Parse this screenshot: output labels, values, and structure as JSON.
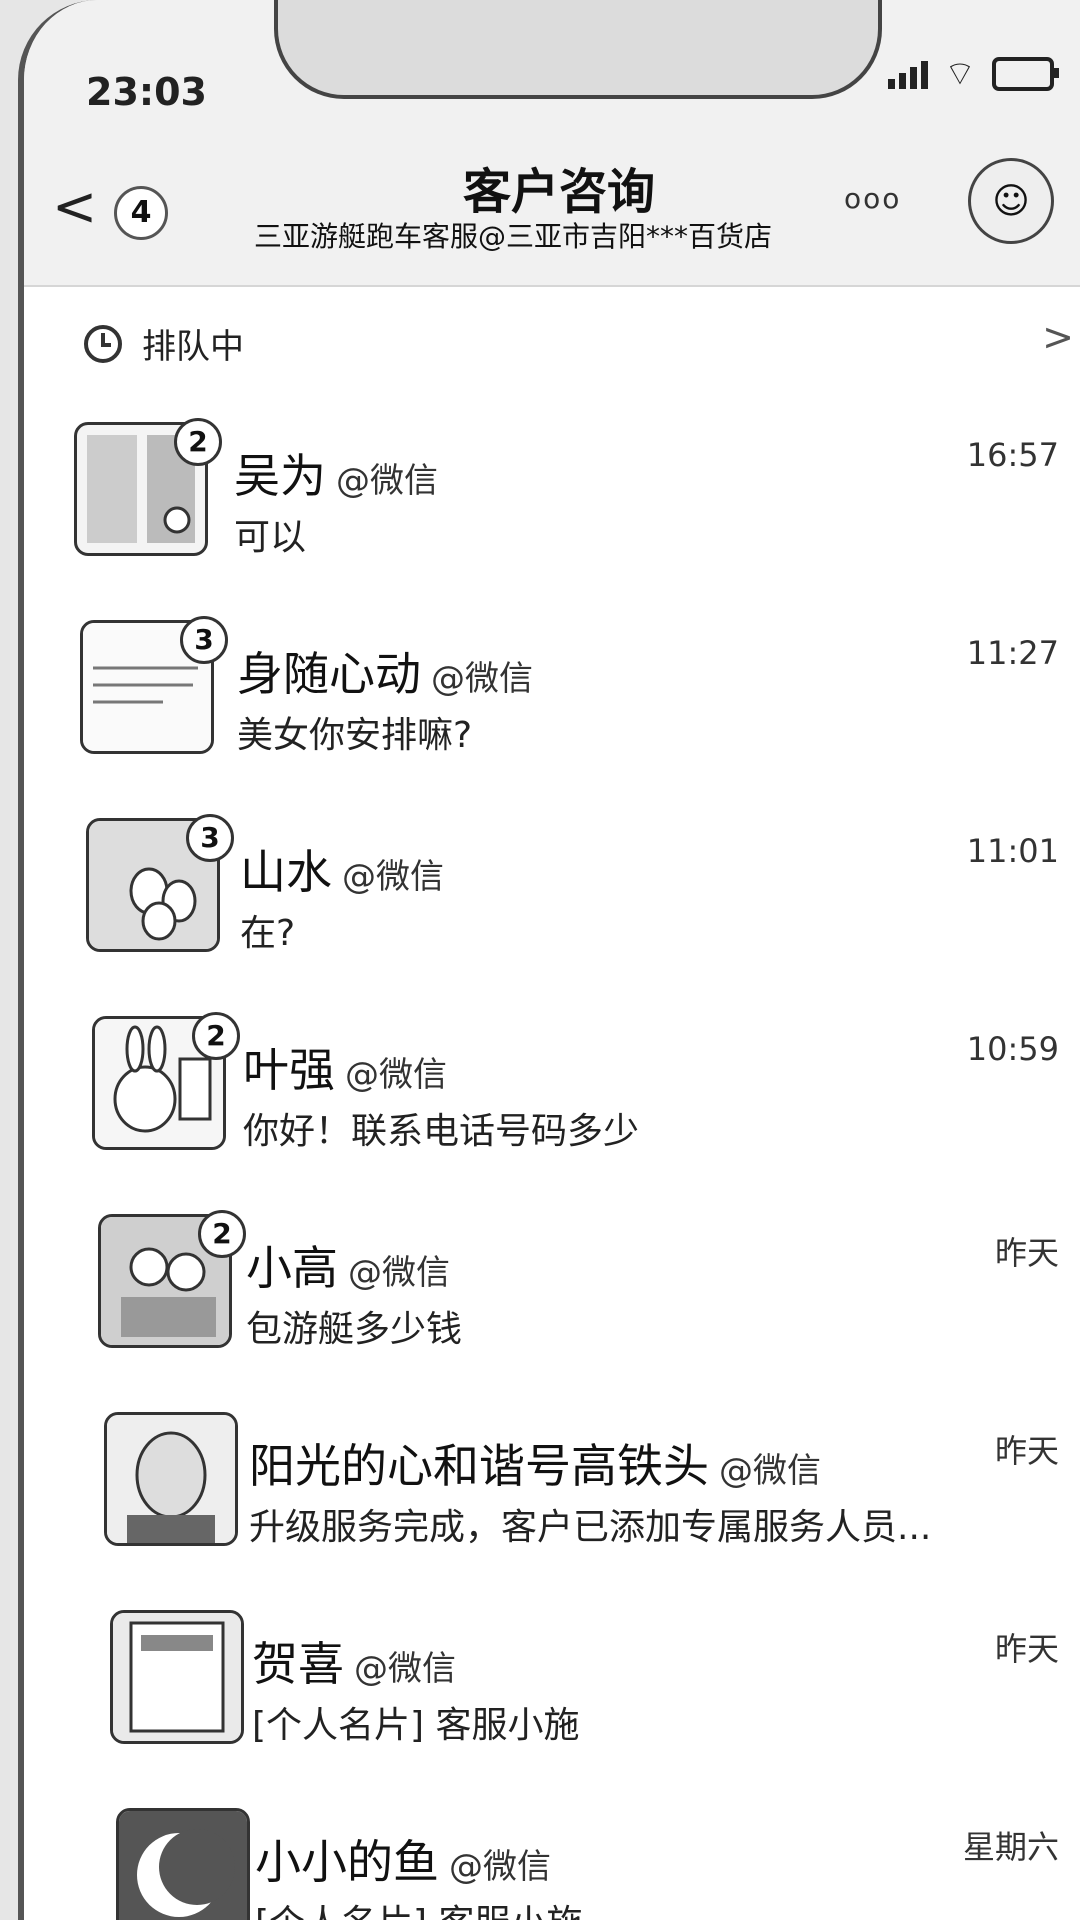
{
  "status_bar": {
    "time": "23:03"
  },
  "header": {
    "back_glyph": "<",
    "unread_count": "4",
    "title": "客户咨询",
    "subtitle": "三亚游艇跑车客服@三亚市吉阳***百货店",
    "more_glyph": "ooo"
  },
  "queue": {
    "label": "排队中",
    "chevron": ">"
  },
  "conversations": [
    {
      "name": "吴为",
      "source": "@微信",
      "preview": "可以",
      "time": "16:57",
      "unread": "2",
      "avatar_icon": "door-photo"
    },
    {
      "name": "身随心动",
      "source": "@微信",
      "preview": "美女你安排嘛?",
      "time": "11:27",
      "unread": "3",
      "avatar_icon": "handwriting-photo"
    },
    {
      "name": "山水",
      "source": "@微信",
      "preview": "在?",
      "time": "11:01",
      "unread": "3",
      "avatar_icon": "eggs-photo"
    },
    {
      "name": "叶强",
      "source": "@微信",
      "preview": "你好！联系电话号码多少",
      "time": "10:59",
      "unread": "2",
      "avatar_icon": "rabbit-photo"
    },
    {
      "name": "小高",
      "source": "@微信",
      "preview": "包游艇多少钱",
      "time": "昨天",
      "unread": "2",
      "avatar_icon": "couple-photo"
    },
    {
      "name": "阳光的心和谐号高铁头",
      "source": "@微信",
      "preview": "升级服务完成，客户已添加专属服务人员...",
      "time": "昨天",
      "unread": "",
      "avatar_icon": "portrait-photo"
    },
    {
      "name": "贺喜",
      "source": "@微信",
      "preview": "[个人名片] 客服小施",
      "time": "昨天",
      "unread": "",
      "avatar_icon": "book-photo"
    },
    {
      "name": "小小的鱼",
      "source": "@微信",
      "preview": "[个人名片] 客服小施",
      "time": "星期六",
      "unread": "",
      "avatar_icon": "moon-photo"
    }
  ]
}
